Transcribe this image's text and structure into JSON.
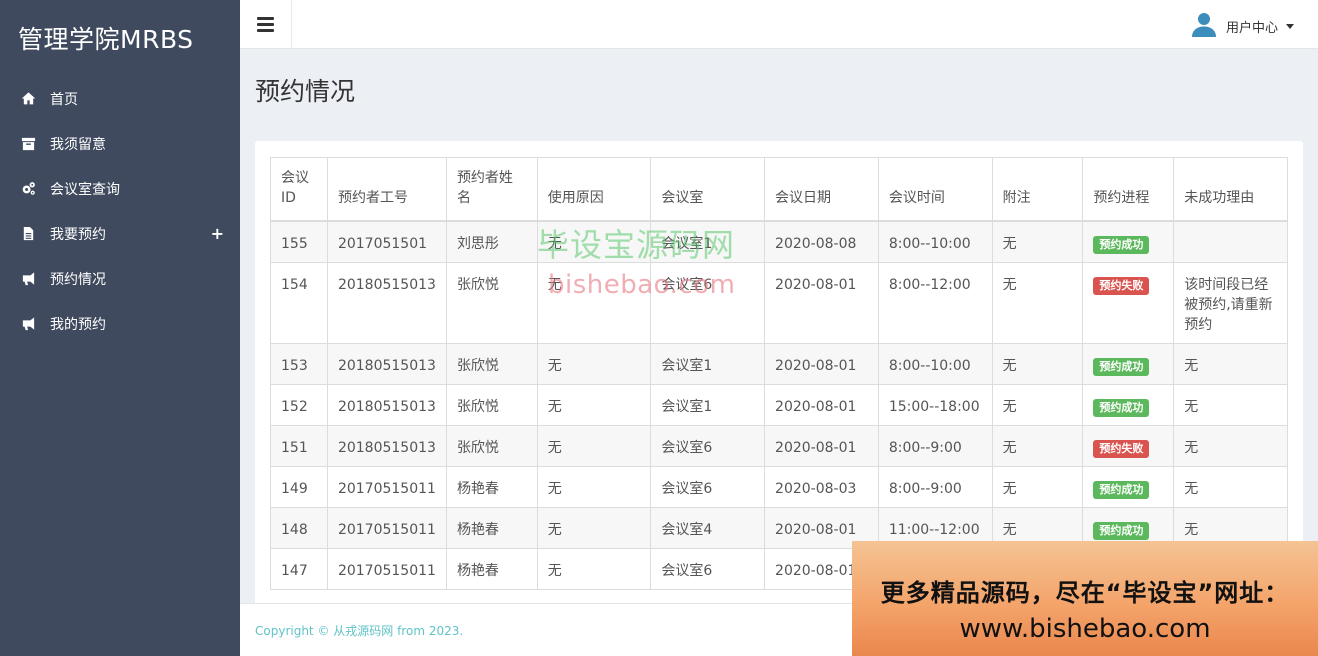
{
  "brand": "管理学院MRBS",
  "sidebar": {
    "items": [
      {
        "label": "首页",
        "icon": "home-icon"
      },
      {
        "label": "我须留意",
        "icon": "archive-icon"
      },
      {
        "label": "会议室查询",
        "icon": "gears-icon"
      },
      {
        "label": "我要预约",
        "icon": "file-icon",
        "expand": "+"
      },
      {
        "label": "预约情况",
        "icon": "bullhorn-icon"
      },
      {
        "label": "我的预约",
        "icon": "bullhorn-icon"
      }
    ]
  },
  "topbar": {
    "user_label": "用户中心"
  },
  "page": {
    "title": "预约情况"
  },
  "table": {
    "headers": [
      "会议\nID",
      "预约者工号",
      "预约者姓\n名",
      "使用原因",
      "会议室",
      "会议日期",
      "会议时间",
      "附注",
      "预约进程",
      "未成功理由"
    ],
    "rows": [
      {
        "id": "155",
        "uid": "2017051501",
        "name": "刘思彤",
        "reason": "无",
        "room": "会议室1",
        "date": "2020-08-08",
        "time": "8:00--10:00",
        "note": "无",
        "status": "预约成功",
        "fail_reason": ""
      },
      {
        "id": "154",
        "uid": "20180515013",
        "name": "张欣悦",
        "reason": "无",
        "room": "会议室6",
        "date": "2020-08-01",
        "time": "8:00--12:00",
        "note": "无",
        "status": "预约失败",
        "fail_reason": "该时间段已经被预约,请重新预约"
      },
      {
        "id": "153",
        "uid": "20180515013",
        "name": "张欣悦",
        "reason": "无",
        "room": "会议室1",
        "date": "2020-08-01",
        "time": "8:00--10:00",
        "note": "无",
        "status": "预约成功",
        "fail_reason": "无"
      },
      {
        "id": "152",
        "uid": "20180515013",
        "name": "张欣悦",
        "reason": "无",
        "room": "会议室1",
        "date": "2020-08-01",
        "time": "15:00--18:00",
        "note": "无",
        "status": "预约成功",
        "fail_reason": "无"
      },
      {
        "id": "151",
        "uid": "20180515013",
        "name": "张欣悦",
        "reason": "无",
        "room": "会议室6",
        "date": "2020-08-01",
        "time": "8:00--9:00",
        "note": "无",
        "status": "预约失败",
        "fail_reason": "无"
      },
      {
        "id": "149",
        "uid": "20170515011",
        "name": "杨艳春",
        "reason": "无",
        "room": "会议室6",
        "date": "2020-08-03",
        "time": "8:00--9:00",
        "note": "无",
        "status": "预约成功",
        "fail_reason": "无"
      },
      {
        "id": "148",
        "uid": "20170515011",
        "name": "杨艳春",
        "reason": "无",
        "room": "会议室4",
        "date": "2020-08-01",
        "time": "11:00--12:00",
        "note": "无",
        "status": "预约成功",
        "fail_reason": "无"
      },
      {
        "id": "147",
        "uid": "20170515011",
        "name": "杨艳春",
        "reason": "无",
        "room": "会议室6",
        "date": "2020-08-01",
        "time": "",
        "note": "",
        "status": "",
        "fail_reason": ""
      }
    ]
  },
  "footer": {
    "text": "Copyright © 从戎源码网 from 2023."
  },
  "watermark": {
    "cn": "毕设宝源码网",
    "en": "bishebao.com"
  },
  "ad": {
    "line1": "更多精品源码，尽在“毕设宝”网址：",
    "line2": "www.bishebao.com"
  },
  "colors": {
    "sidebar": "#3f4a5e",
    "success": "#5cb85c",
    "danger": "#d9534f",
    "footer_text": "#5fc3c8"
  }
}
